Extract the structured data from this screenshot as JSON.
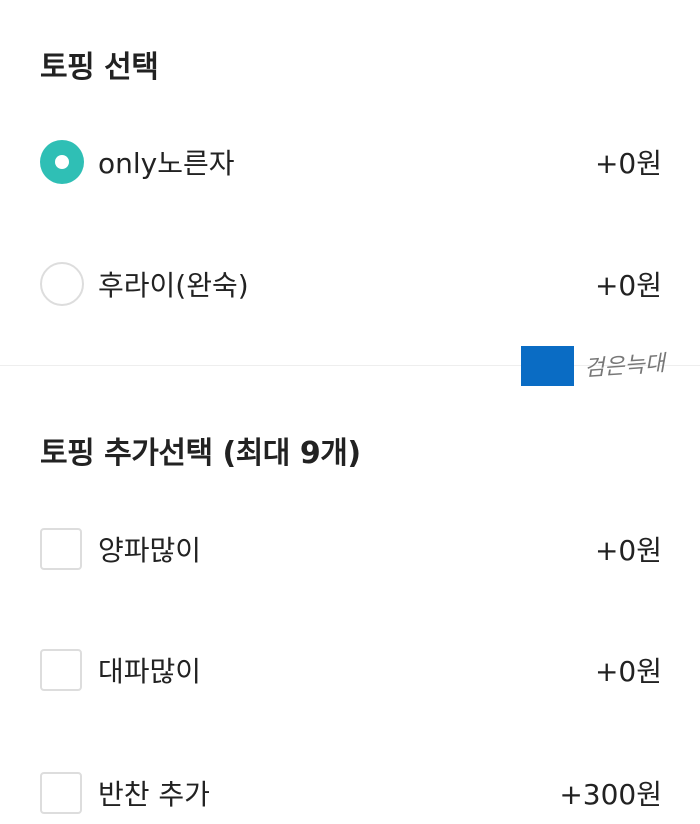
{
  "sections": [
    {
      "title": "토핑 선택",
      "options": [
        {
          "label": "only노른자",
          "price": "+0원",
          "selected": true
        },
        {
          "label": "후라이(완숙)",
          "price": "+0원",
          "selected": false
        }
      ]
    },
    {
      "title": "토핑 추가선택 (최대 9개)",
      "options": [
        {
          "label": "양파많이",
          "price": "+0원",
          "checked": false
        },
        {
          "label": "대파많이",
          "price": "+0원",
          "checked": false
        },
        {
          "label": "반찬 추가",
          "price": "+300원",
          "checked": false
        }
      ]
    }
  ],
  "watermark": {
    "text": "검은늑대",
    "box_color": "#0a6cc4"
  },
  "colors": {
    "accent": "#2fbfb5",
    "control_border": "#dddddd",
    "divider": "#eeeeee",
    "text": "#222222"
  }
}
